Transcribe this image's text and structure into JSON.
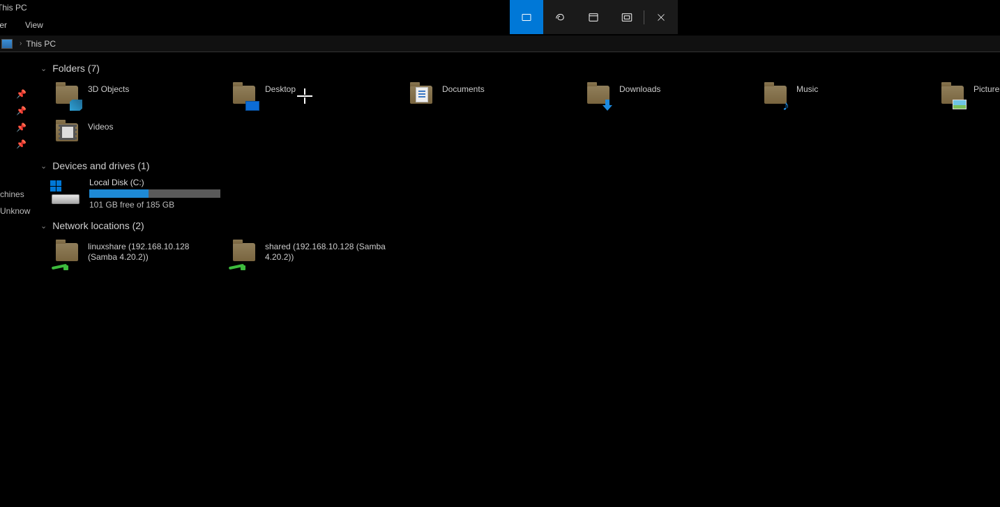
{
  "window": {
    "title": "This PC"
  },
  "ribbon": {
    "tabs": [
      "Computer",
      "View"
    ],
    "tab_partial": "ter",
    "tab_view": "View"
  },
  "address": {
    "location": "This PC"
  },
  "nav": {
    "pinned": [
      "s",
      "s",
      "s",
      ""
    ],
    "cut_labels": {
      "machines": "chines",
      "unknown": "Unknow"
    }
  },
  "snip": {
    "mode": "rectangular"
  },
  "sections": {
    "folders": {
      "title": "Folders (7)",
      "items": [
        {
          "label": "3D Objects"
        },
        {
          "label": "Desktop"
        },
        {
          "label": "Documents"
        },
        {
          "label": "Downloads"
        },
        {
          "label": "Music"
        },
        {
          "label": "Pictures"
        },
        {
          "label": "Videos"
        }
      ]
    },
    "drives": {
      "title": "Devices and drives (1)",
      "items": [
        {
          "label": "Local Disk (C:)",
          "free_text": "101 GB free of 185 GB",
          "used_pct": 45
        }
      ]
    },
    "network": {
      "title": "Network locations (2)",
      "items": [
        {
          "label": "linuxshare (192.168.10.128 (Samba 4.20.2))"
        },
        {
          "label": "shared (192.168.10.128 (Samba 4.20.2))"
        }
      ]
    }
  }
}
